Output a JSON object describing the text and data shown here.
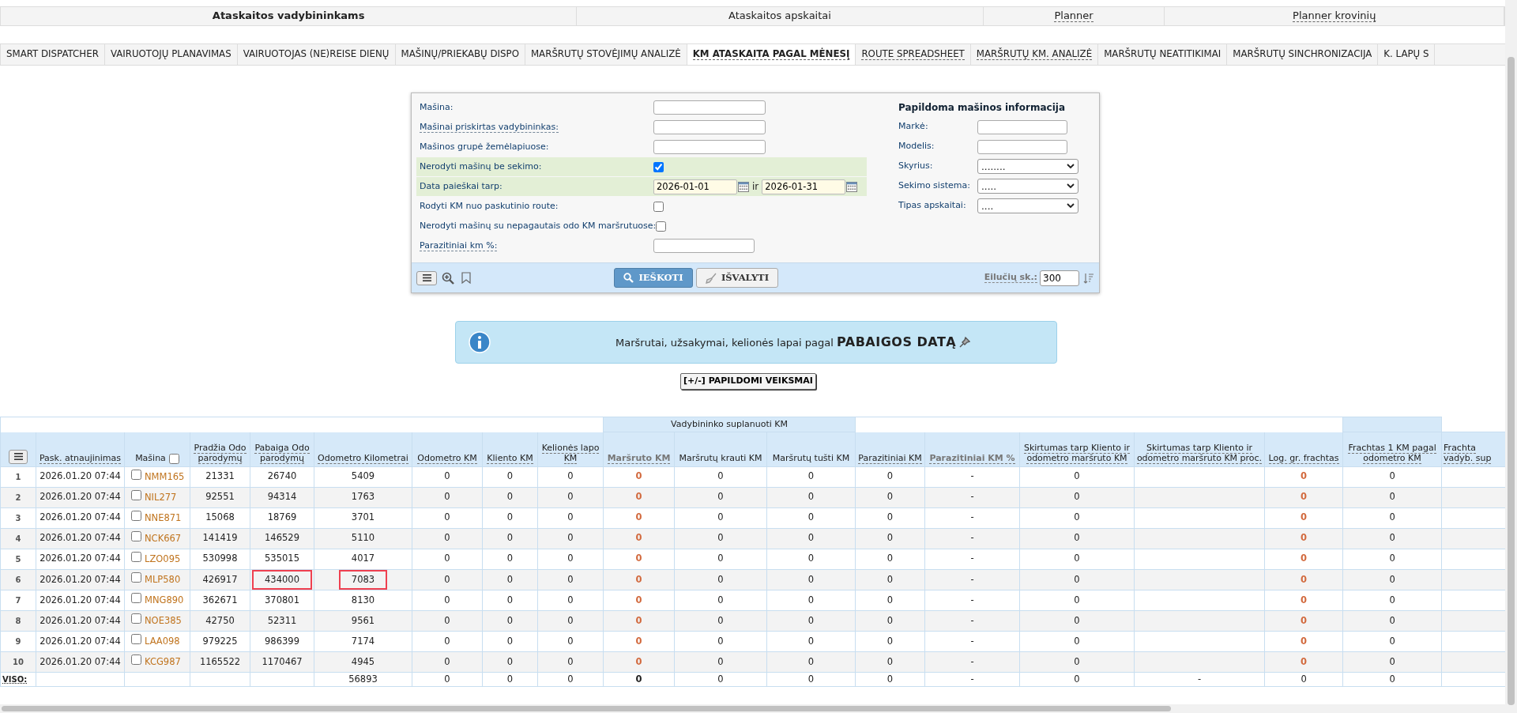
{
  "top_menu": [
    {
      "label": "Ataskaitos vadybininkams",
      "selected": true,
      "hint": false
    },
    {
      "label": "Ataskaitos apskaitai",
      "selected": false,
      "hint": false
    },
    {
      "label": "Planner",
      "selected": false,
      "hint": true
    },
    {
      "label": "Planner krovinių",
      "selected": false,
      "hint": true
    }
  ],
  "tabs": [
    {
      "label": "SMART DISPATCHER",
      "selected": false,
      "hint": false
    },
    {
      "label": "VAIRUOTOJŲ PLANAVIMAS",
      "selected": false,
      "hint": false
    },
    {
      "label": "VAIRUOTOJAS (NE)REISE DIENŲ",
      "selected": false,
      "hint": false
    },
    {
      "label": "MAŠINŲ/PRIEKABŲ DISPO",
      "selected": false,
      "hint": false
    },
    {
      "label": "MARŠRUTŲ STOVĖJIMŲ ANALIZĖ",
      "selected": false,
      "hint": false
    },
    {
      "label": "KM ATASKAITA PAGAL MĖNESĮ",
      "selected": true,
      "hint": true
    },
    {
      "label": "ROUTE SPREADSHEET",
      "selected": false,
      "hint": true
    },
    {
      "label": "MARŠRUTŲ KM. ANALIZĖ",
      "selected": false,
      "hint": true
    },
    {
      "label": "MARŠRUTŲ NEATITIKIMAI",
      "selected": false,
      "hint": false
    },
    {
      "label": "MARŠRUTŲ SINCHRONIZACIJA",
      "selected": false,
      "hint": false
    },
    {
      "label": "K. LAPŲ S",
      "selected": false,
      "hint": false
    }
  ],
  "filter": {
    "fields": [
      {
        "kind": "text",
        "label": "Mašina:",
        "hint": false,
        "highlighted": false
      },
      {
        "kind": "text",
        "label": "Mašinai priskirtas vadybininkas:",
        "hint": true,
        "highlighted": false
      },
      {
        "kind": "text",
        "label": "Mašinos grupė žemėlapiuose:",
        "hint": false,
        "highlighted": false
      },
      {
        "kind": "checkbox",
        "label": "Nerodyti mašinų be sekimo:",
        "hint": false,
        "highlighted": true,
        "checked": true
      },
      {
        "kind": "daterange",
        "label": "Data paieškai tarp:",
        "hint": false,
        "highlighted": true,
        "from": "2026-01-01",
        "joiner": "ir",
        "to": "2026-01-31"
      },
      {
        "kind": "checkbox",
        "label": "Rodyti KM nuo paskutinio route:",
        "hint": false,
        "highlighted": false,
        "checked": false
      },
      {
        "kind": "checkbox",
        "label": "Nerodyti mašinų su nepagautais odo KM maršrutuose:",
        "hint": false,
        "highlighted": false,
        "checked": false
      },
      {
        "kind": "short",
        "label": "Parazitiniai km %:",
        "hint": true,
        "highlighted": false
      }
    ],
    "extra_title": "Papildoma mašinos informacija",
    "extra_fields": [
      {
        "kind": "text",
        "label": "Markė:"
      },
      {
        "kind": "text",
        "label": "Modelis:"
      },
      {
        "kind": "select",
        "label": "Skyrius:",
        "value": "........"
      },
      {
        "kind": "select",
        "label": "Sekimo sistema:",
        "value": "....."
      },
      {
        "kind": "select",
        "label": "Tipas apskaitai:",
        "value": "...."
      }
    ],
    "search_button": "IEŠKOTI",
    "clear_button": "IŠVALYTI",
    "rows_label": "Eilučių sk.:",
    "rows_value": "300"
  },
  "info": {
    "text": "Maršrutai, užsakymai, kelionės lapai pagal **PABAIGOS DATĄ**"
  },
  "actions_button": "[+/-] PAPILDOMI VEIKSMAI",
  "table": {
    "group_header": "Vadybininko suplanuoti KM",
    "columns": [
      {
        "kind": "text",
        "label": "Pask. atnaujinimas",
        "hint": true,
        "muted": false
      },
      {
        "kind": "vehicle",
        "label": "Mašina",
        "hint": false,
        "muted": false,
        "checked": false
      },
      {
        "kind": "text",
        "label": "Pradžia Odo parodymų",
        "hint": true,
        "muted": false
      },
      {
        "kind": "text",
        "label": "Pabaiga Odo parodymų",
        "hint": true,
        "muted": false
      },
      {
        "kind": "text",
        "label": "Odometro Kilometrai",
        "hint": true,
        "muted": false
      },
      {
        "kind": "text",
        "label": "Odometro KM",
        "hint": true,
        "muted": false
      },
      {
        "kind": "text",
        "label": "Kliento KM",
        "hint": true,
        "muted": false
      },
      {
        "kind": "text",
        "label": "Kelionės lapo KM",
        "hint": true,
        "muted": false
      },
      {
        "kind": "text",
        "label": "Maršruto KM",
        "hint": true,
        "muted": true
      },
      {
        "kind": "text",
        "label": "Maršrutų krauti KM",
        "hint": false,
        "muted": false
      },
      {
        "kind": "text",
        "label": "Maršrutų tušti KM",
        "hint": false,
        "muted": false
      },
      {
        "kind": "text",
        "label": "Parazitiniai KM",
        "hint": true,
        "muted": false
      },
      {
        "kind": "text",
        "label": "Parazitiniai KM %",
        "hint": true,
        "muted": true
      },
      {
        "kind": "text",
        "label": "Skirtumas tarp Kliento ir odometro maršruto KM",
        "hint": true,
        "muted": false
      },
      {
        "kind": "text",
        "label": "Skirtumas tarp Kliento ir odometro maršruto KM proc.",
        "hint": true,
        "muted": false
      },
      {
        "kind": "text",
        "label": "Log. gr. frachtas",
        "hint": true,
        "muted": false
      },
      {
        "kind": "text",
        "label": "Frachtas 1 KM pagal odometro KM",
        "hint": true,
        "muted": false
      },
      {
        "kind": "text",
        "label": "Frachta vadyb. sup",
        "hint": true,
        "muted": false
      }
    ],
    "rows": [
      {
        "no": "1",
        "checked": false,
        "cells": [
          "2026.01.20 07:44",
          "NMM165",
          "21331",
          "26740",
          "5409",
          "0",
          "0",
          "0",
          {
            "text": "0",
            "accent": true
          },
          "0",
          "0",
          "0",
          "-",
          "0",
          "",
          {
            "text": "0",
            "accent": true
          },
          "0",
          ""
        ]
      },
      {
        "no": "2",
        "checked": false,
        "cells": [
          "2026.01.20 07:44",
          "NIL277",
          "92551",
          "94314",
          "1763",
          "0",
          "0",
          "0",
          {
            "text": "0",
            "accent": true
          },
          "0",
          "0",
          "0",
          "-",
          "0",
          "",
          {
            "text": "0",
            "accent": true
          },
          "0",
          ""
        ]
      },
      {
        "no": "3",
        "checked": false,
        "cells": [
          "2026.01.20 07:44",
          "NNE871",
          "15068",
          "18769",
          "3701",
          "0",
          "0",
          "0",
          {
            "text": "0",
            "accent": true
          },
          "0",
          "0",
          "0",
          "-",
          "0",
          "",
          {
            "text": "0",
            "accent": true
          },
          "0",
          ""
        ]
      },
      {
        "no": "4",
        "checked": false,
        "cells": [
          "2026.01.20 07:44",
          "NCK667",
          "141419",
          "146529",
          "5110",
          "0",
          "0",
          "0",
          {
            "text": "0",
            "accent": true
          },
          "0",
          "0",
          "0",
          "-",
          "0",
          "",
          {
            "text": "0",
            "accent": true
          },
          "0",
          ""
        ]
      },
      {
        "no": "5",
        "checked": false,
        "cells": [
          "2026.01.20 07:44",
          "LZO095",
          "530998",
          "535015",
          "4017",
          "0",
          "0",
          "0",
          {
            "text": "0",
            "accent": true
          },
          "0",
          "0",
          "0",
          "-",
          "0",
          "",
          {
            "text": "0",
            "accent": true
          },
          "0",
          ""
        ]
      },
      {
        "no": "6",
        "checked": false,
        "cells": [
          "2026.01.20 07:44",
          "MLP580",
          "426917",
          {
            "text": "434000",
            "marked": true
          },
          {
            "text": "7083",
            "marked": true
          },
          "0",
          "0",
          "0",
          {
            "text": "0",
            "accent": true
          },
          "0",
          "0",
          "0",
          "-",
          "0",
          "",
          {
            "text": "0",
            "accent": true
          },
          "0",
          ""
        ]
      },
      {
        "no": "7",
        "checked": false,
        "cells": [
          "2026.01.20 07:44",
          "MNG890",
          "362671",
          "370801",
          "8130",
          "0",
          "0",
          "0",
          {
            "text": "0",
            "accent": true
          },
          "0",
          "0",
          "0",
          "-",
          "0",
          "",
          {
            "text": "0",
            "accent": true
          },
          "0",
          ""
        ]
      },
      {
        "no": "8",
        "checked": false,
        "cells": [
          "2026.01.20 07:44",
          "NOE385",
          "42750",
          "52311",
          "9561",
          "0",
          "0",
          "0",
          {
            "text": "0",
            "accent": true
          },
          "0",
          "0",
          "0",
          "-",
          "0",
          "",
          {
            "text": "0",
            "accent": true
          },
          "0",
          ""
        ]
      },
      {
        "no": "9",
        "checked": false,
        "cells": [
          "2026.01.20 07:44",
          "LAA098",
          "979225",
          "986399",
          "7174",
          "0",
          "0",
          "0",
          {
            "text": "0",
            "accent": true
          },
          "0",
          "0",
          "0",
          "-",
          "0",
          "",
          {
            "text": "0",
            "accent": true
          },
          "0",
          ""
        ]
      },
      {
        "no": "10",
        "checked": false,
        "cells": [
          "2026.01.20 07:44",
          "KCG987",
          "1165522",
          "1170467",
          "4945",
          "0",
          "0",
          "0",
          {
            "text": "0",
            "accent": true
          },
          "0",
          "0",
          "0",
          "-",
          "0",
          "",
          {
            "text": "0",
            "accent": true
          },
          "0",
          ""
        ]
      }
    ],
    "totals": {
      "label": "VISO:",
      "cells": [
        "",
        "",
        "",
        "",
        "56893",
        "0",
        "0",
        "0",
        {
          "text": "0",
          "bold": true
        },
        "0",
        "0",
        "0",
        "-",
        "0",
        "-",
        "0",
        "0",
        ""
      ]
    }
  }
}
